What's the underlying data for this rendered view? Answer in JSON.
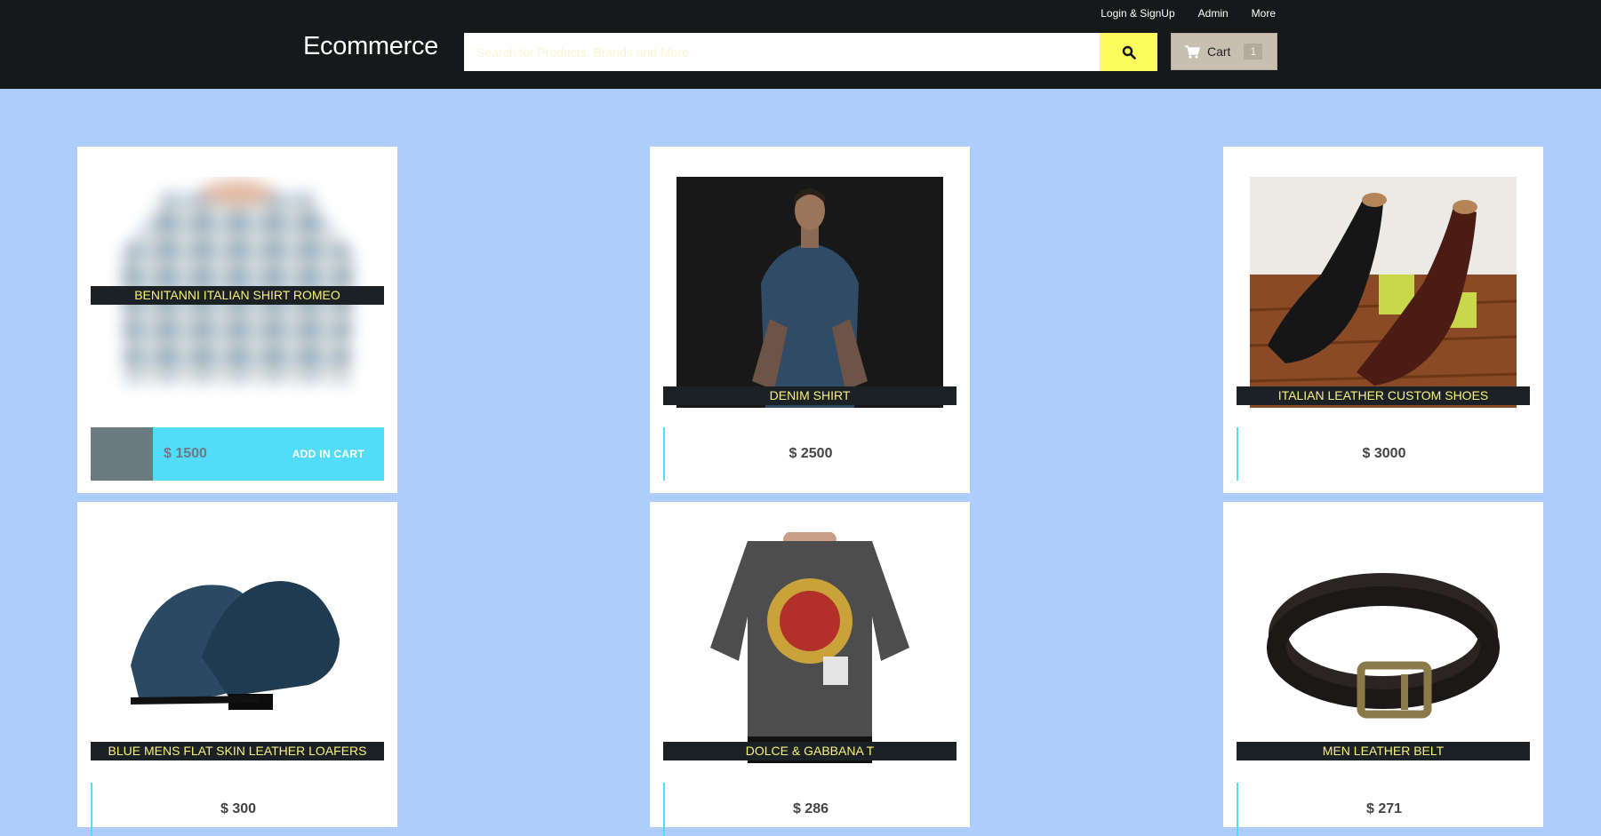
{
  "header": {
    "links": [
      "Login & SignUp",
      "Admin",
      "More"
    ],
    "brand": "Ecommerce",
    "search_placeholder": "Search for Products, Brands and More",
    "cart_label": "Cart",
    "cart_count": "1"
  },
  "colors": {
    "topbar": "#16191a",
    "background": "#aecdfb",
    "search_button": "#fcfc5c",
    "price_accent": "#52dcf7",
    "title_text": "#f8f27a"
  },
  "products": [
    {
      "title": "BENITANNI ITALIAN SHIRT ROMEO",
      "price": "$ 1500",
      "image": "blurred-patterned-shirt",
      "action": "ADD IN CART"
    },
    {
      "title": "DENIM SHIRT",
      "price": "$ 2500",
      "image": "man-in-denim-shirt"
    },
    {
      "title": "ITALIAN LEATHER CUSTOM SHOES",
      "price": "$ 3000",
      "image": "leather-oxford-shoes"
    },
    {
      "title": "BLUE MENS FLAT SKIN LEATHER LOAFERS",
      "price": "$ 300",
      "image": "blue-loafers"
    },
    {
      "title": "DOLCE & GABBANA T",
      "price": "$ 286",
      "image": "printed-t-shirt"
    },
    {
      "title": "MEN LEATHER BELT",
      "price": "$ 271",
      "image": "leather-belt"
    }
  ]
}
